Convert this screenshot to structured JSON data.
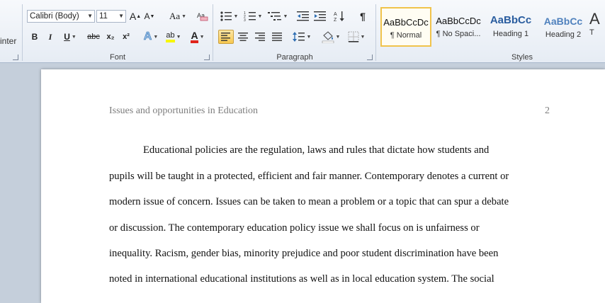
{
  "ribbon": {
    "clipboard": {
      "painter_label": "inter"
    },
    "font": {
      "label": "Font",
      "font_name": "Calibri (Body)",
      "font_size": "11",
      "grow_label": "A",
      "shrink_label": "A",
      "change_case_label": "Aa",
      "bold": "B",
      "italic": "I",
      "underline": "U",
      "strike": "abc",
      "subscript": "x₂",
      "superscript": "x²",
      "text_effects": "A",
      "highlight": "ab",
      "font_color": "A"
    },
    "paragraph": {
      "label": "Paragraph",
      "pilcrow": "¶"
    },
    "styles": {
      "label": "Styles",
      "items": [
        {
          "sample": "AaBbCcDc",
          "name": "¶ Normal"
        },
        {
          "sample": "AaBbCcDc",
          "name": "¶ No Spaci..."
        },
        {
          "sample": "AaBbCc",
          "name": "Heading 1"
        },
        {
          "sample": "AaBbCc",
          "name": "Heading 2"
        },
        {
          "sample": "A",
          "name": "T"
        }
      ]
    }
  },
  "document": {
    "header_title": "Issues and opportunities in Education",
    "page_number": "2",
    "lines": [
      "Educational policies  are the regulation, laws and rules that dictate how students and",
      "pupils will be taught in a protected, efficient and fair manner. Contemporary denotes a current or",
      "modern issue of concern.  Issues can be taken to mean a problem  or a topic that can spur a debate",
      "or discussion. The contemporary education policy issue we shall focus on is unfairness or",
      "inequality. Racism, gender bias, minority prejudice and poor student discrimination have been",
      "noted in international educational institutions as well as in local education system. The social"
    ]
  }
}
